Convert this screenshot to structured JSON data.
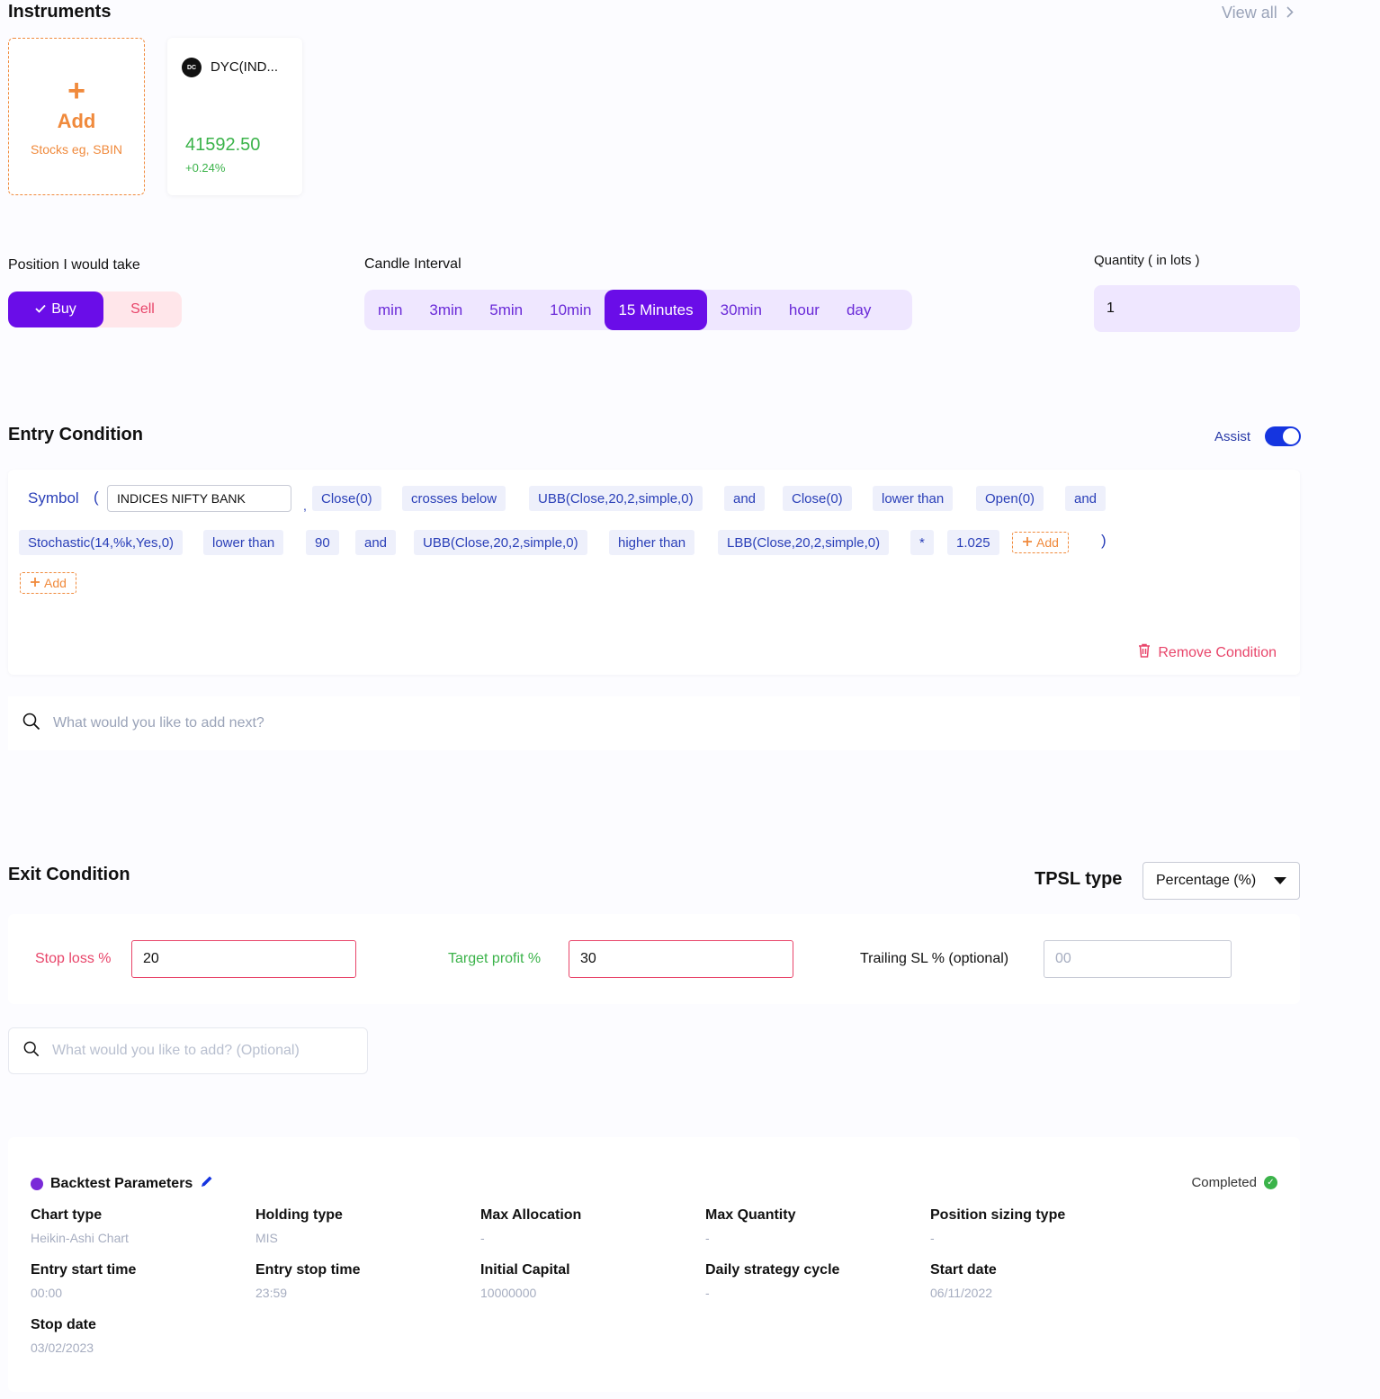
{
  "instruments": {
    "title": "Instruments",
    "view_all": "View all",
    "add_card": {
      "plus": "+",
      "label": "Add",
      "sub": "Stocks eg, SBIN"
    },
    "card": {
      "logo": "DC",
      "name": "DYC(IND...",
      "price": "41592.50",
      "change": "+0.24%"
    }
  },
  "position": {
    "label": "Position I would take",
    "buy": "Buy",
    "sell": "Sell",
    "selected": "Buy"
  },
  "candle": {
    "label": "Candle Interval",
    "options": [
      "min",
      "3min",
      "5min",
      "10min",
      "15 Minutes",
      "30min",
      "hour",
      "day"
    ],
    "selected": "15 Minutes"
  },
  "quantity": {
    "label": "Quantity ( in lots )",
    "value": "1"
  },
  "entry": {
    "title": "Entry Condition",
    "assist_label": "Assist",
    "symbol_label": "Symbol",
    "open_paren": "(",
    "close_paren": ")",
    "comma": ",",
    "symbol_value": "INDICES NIFTY BANK",
    "row1": [
      "Close(0)",
      "crosses below",
      "UBB(Close,20,2,simple,0)",
      "and",
      "Close(0)",
      "lower than",
      "Open(0)",
      "and"
    ],
    "row2": [
      "Stochastic(14,%k,Yes,0)",
      "lower than",
      "90",
      "and",
      "UBB(Close,20,2,simple,0)",
      "higher than",
      "LBB(Close,20,2,simple,0)",
      "*",
      "1.025"
    ],
    "add_label": "Add",
    "remove_label": "Remove Condition",
    "search_placeholder": "What would you like to add next?"
  },
  "exit": {
    "title": "Exit Condition",
    "tpsl_label": "TPSL type",
    "tpsl_value": "Percentage (%)",
    "stop_loss_label": "Stop loss %",
    "stop_loss_value": "20",
    "target_label": "Target profit %",
    "target_value": "30",
    "trailing_label": "Trailing SL % (optional)",
    "trailing_placeholder": "00",
    "search_placeholder": "What would you like to add? (Optional)"
  },
  "backtest": {
    "title": "Backtest Parameters",
    "status": "Completed",
    "items": [
      {
        "k": "Chart type",
        "v": "Heikin-Ashi Chart"
      },
      {
        "k": "Holding type",
        "v": "MIS"
      },
      {
        "k": "Max Allocation",
        "v": "-"
      },
      {
        "k": "Max Quantity",
        "v": "-"
      },
      {
        "k": "Position sizing type",
        "v": "-"
      },
      {
        "k": "Entry start time",
        "v": "00:00"
      },
      {
        "k": "Entry stop time",
        "v": "23:59"
      },
      {
        "k": "Initial Capital",
        "v": "10000000"
      },
      {
        "k": "Daily strategy cycle",
        "v": "-"
      },
      {
        "k": "Start date",
        "v": "06/11/2022"
      },
      {
        "k": "Stop date",
        "v": "03/02/2023"
      }
    ]
  },
  "colors": {
    "primary": "#6a0de8",
    "accent_orange": "#f08a3c",
    "chip_text": "#2a3fb8",
    "danger": "#e8456a",
    "success": "#3bb34a"
  }
}
